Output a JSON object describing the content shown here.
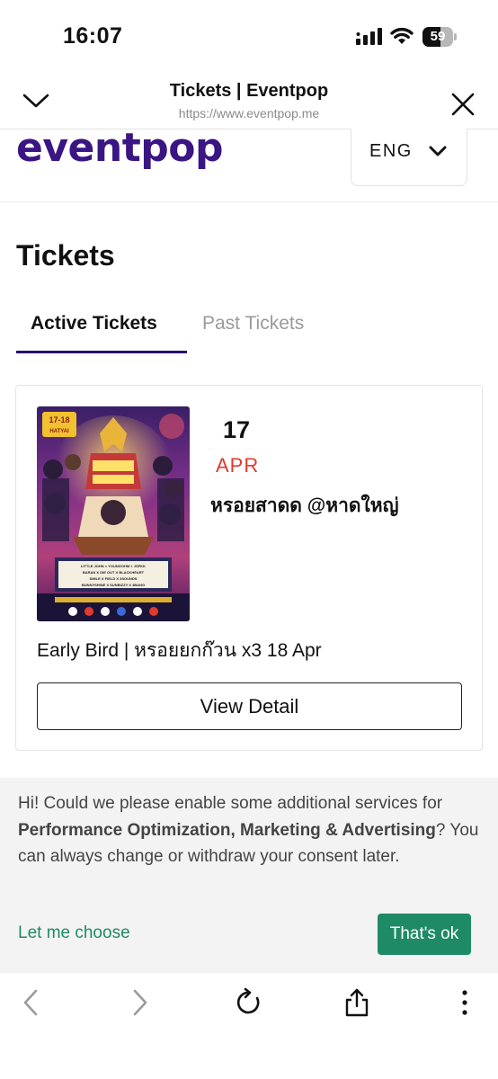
{
  "status_bar": {
    "time": "16:07",
    "battery": "59",
    "battery_level": 0.59
  },
  "browser": {
    "title": "Tickets | Eventpop",
    "url": "https://www.eventpop.me"
  },
  "site": {
    "logo": "eventpop",
    "language": "ENG",
    "brand_color": "#3a1583"
  },
  "page": {
    "title": "Tickets",
    "tabs": [
      {
        "label": "Active Tickets",
        "active": true
      },
      {
        "label": "Past Tickets",
        "active": false
      }
    ]
  },
  "ticket": {
    "day": "17",
    "month": "APR",
    "event_name": "หรอยสาดด @หาดใหญ่",
    "ticket_type": "Early Bird | หรอยยกก๊วน x3 18 Apr",
    "button_label": "View Detail",
    "poster": {
      "date_badge": "17-18",
      "city": "HATYAI",
      "lineup": [
        "LITTLE JOHN × YOUNGOHM × JSPKK",
        "BARAN X DIE OUT X BLACKHEART",
        "SMILE X FIELD X 3SOUNDS",
        "BUNNYSHINE X SUNBIZZY X 4BANG"
      ]
    }
  },
  "consent": {
    "text_start": "Hi! Could we please enable some additional services for ",
    "text_bold": "Performance Optimization, Marketing & Advertising",
    "text_end": "? You can always change or withdraw your consent later.",
    "choose_label": "Let me choose",
    "accept_label": "That's ok",
    "accent_color": "#1f8a66"
  },
  "toolbar": {
    "icons": [
      "back-icon",
      "forward-icon",
      "reload-icon",
      "share-icon",
      "more-icon"
    ]
  }
}
